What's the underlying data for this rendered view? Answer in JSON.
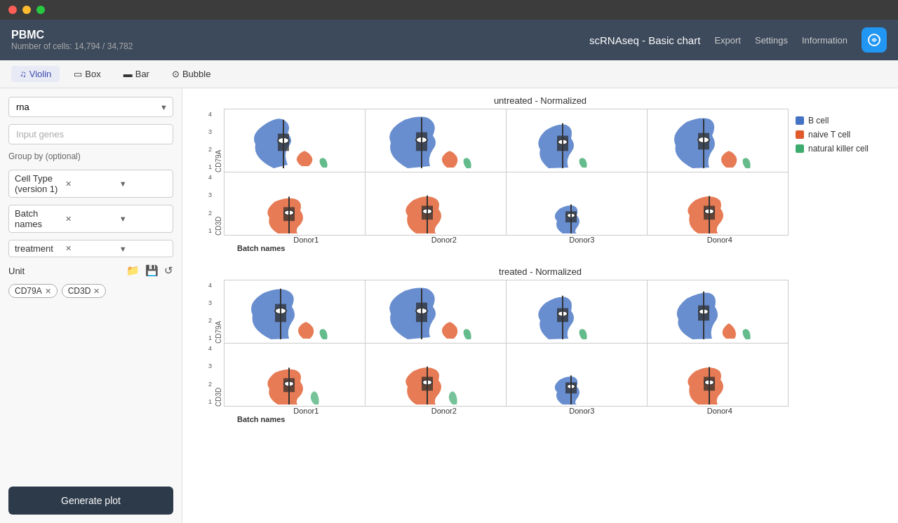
{
  "titlebar": {
    "traffic": [
      "red",
      "yellow",
      "green"
    ]
  },
  "header": {
    "title": "PBMC",
    "cell_count": "Number of cells: 14,794 / 34,782",
    "app_title": "scRNAseq - Basic chart",
    "export": "Export",
    "settings": "Settings",
    "information": "Information"
  },
  "toolbar": {
    "tabs": [
      {
        "label": "Violin",
        "icon": "♪",
        "active": true
      },
      {
        "label": "Box",
        "icon": "▭",
        "active": false
      },
      {
        "label": "Bar",
        "icon": "▬",
        "active": false
      },
      {
        "label": "Bubble",
        "icon": "⊙",
        "active": false
      }
    ]
  },
  "sidebar": {
    "rna_value": "rna",
    "input_genes_placeholder": "Input genes",
    "group_by_label": "Group by (optional)",
    "group_by_items": [
      {
        "label": "Cell Type (version 1)"
      },
      {
        "label": "Batch names"
      },
      {
        "label": "treatment"
      }
    ],
    "unit_label": "Unit",
    "genes": [
      {
        "label": "CD79A"
      },
      {
        "label": "CD3D"
      }
    ],
    "generate_btn": "Generate plot"
  },
  "chart": {
    "sections": [
      {
        "title": "untreated - Normalized",
        "donors": [
          "Donor1",
          "Donor2",
          "Donor3",
          "Donor4"
        ],
        "genes": [
          "CD79A",
          "CD3D"
        ],
        "x_axis_label": "Batch names"
      },
      {
        "title": "treated - Normalized",
        "donors": [
          "Donor1",
          "Donor2",
          "Donor3",
          "Donor4"
        ],
        "genes": [
          "CD79A",
          "CD3D"
        ],
        "x_axis_label": "Batch names"
      }
    ],
    "legend": [
      {
        "label": "B cell",
        "color": "#4472C4"
      },
      {
        "label": "naive T cell",
        "color": "#E05A2B"
      },
      {
        "label": "natural killer cell",
        "color": "#3DAA6E"
      }
    ],
    "y_ticks": [
      "4",
      "3",
      "2",
      "1"
    ]
  }
}
